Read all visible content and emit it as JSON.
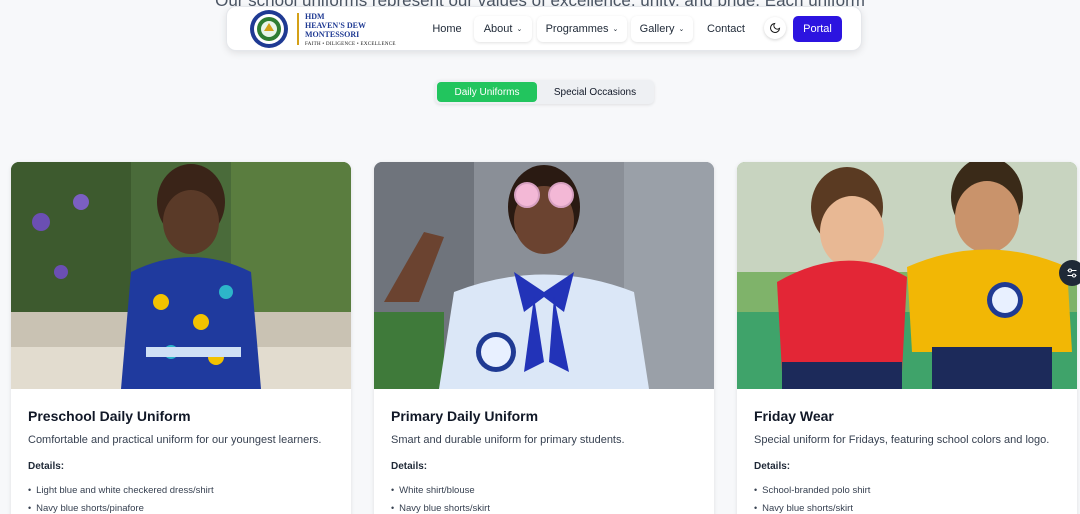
{
  "intro_text": "Our school uniforms represent our values of excellence, unity, and pride. Each uniform",
  "brand": {
    "line1": "HDM",
    "line2": "HEAVEN'S DEW",
    "line3": "MONTESSORI",
    "tagline": "FAITH  •  DILIGENCE  •  EXCELLENCE"
  },
  "nav": {
    "home": "Home",
    "about": "About",
    "programmes": "Programmes",
    "gallery": "Gallery",
    "contact": "Contact",
    "portal": "Portal"
  },
  "tabs": {
    "daily": "Daily Uniforms",
    "special": "Special Occasions"
  },
  "cards": [
    {
      "title": "Preschool Daily Uniform",
      "description": "Comfortable and practical uniform for our youngest learners.",
      "details_label": "Details:",
      "details": [
        "Light blue and white checkered dress/shirt",
        "Navy blue shorts/pinafore"
      ]
    },
    {
      "title": "Primary Daily Uniform",
      "description": "Smart and durable uniform for primary students.",
      "details_label": "Details:",
      "details": [
        "White shirt/blouse",
        "Navy blue shorts/skirt"
      ]
    },
    {
      "title": "Friday Wear",
      "description": "Special uniform for Fridays, featuring school colors and logo.",
      "details_label": "Details:",
      "details": [
        "School-branded polo shirt",
        "Navy blue shorts/skirt"
      ]
    }
  ],
  "colors": {
    "accent": "#2c14e0",
    "tab_active": "#22c55e",
    "brand_text": "#1f3a93"
  }
}
